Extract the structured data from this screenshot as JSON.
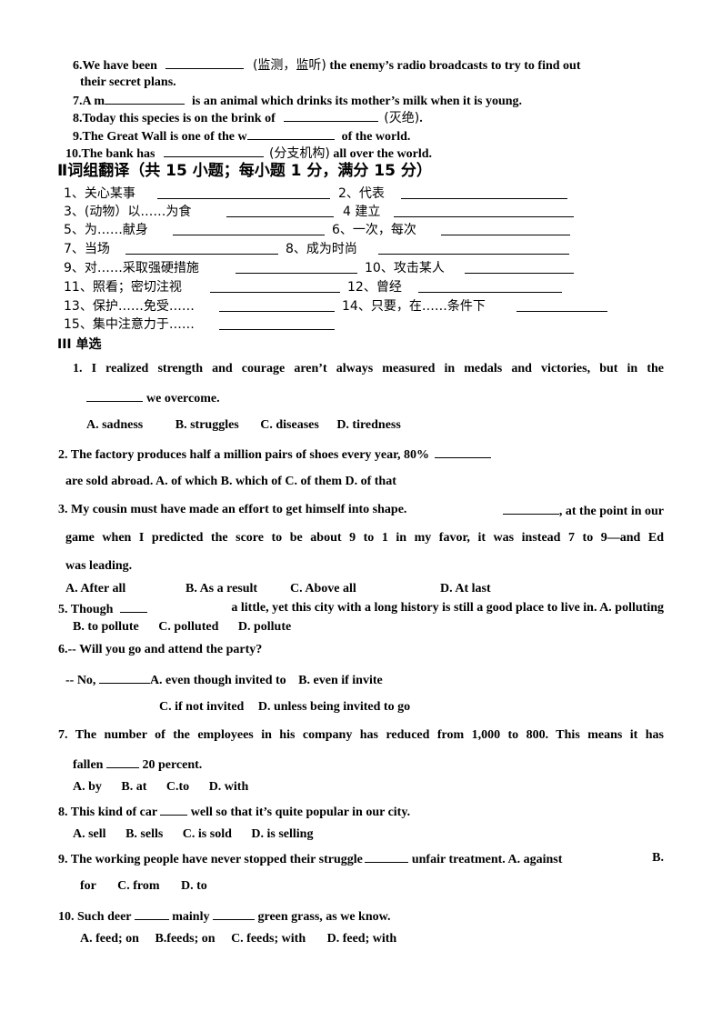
{
  "section1_tail": [
    {
      "num": "6.",
      "before": "We have been",
      "hint": "(监测，监听)",
      "after": "the enemy’s radio broadcasts to try to find out",
      "cont": "their secret plans."
    },
    {
      "num": "7.",
      "before": "A m",
      "after": "is an animal which drinks its mother’s milk when it is young."
    },
    {
      "num": "8.",
      "before": "Today this species is on the brink of",
      "hint": "(灭绝)",
      "after": "."
    },
    {
      "num": "9.",
      "before": "The Great Wall is one of the w",
      "after": "of the world."
    },
    {
      "num": "10.",
      "before": "The bank has",
      "hint": "(分支机构)",
      "after": "all over the world."
    }
  ],
  "section2": {
    "title": "Ⅱ词组翻译（共 15 小题；每小题 1 分，满分 15 分）",
    "items": [
      "1、关心某事",
      "2、代表",
      "3、(动物）以……为食",
      "4 建立",
      "5、为……献身",
      "6、一次，每次",
      "7、当场",
      "8、成为时尚",
      "9、对……采取强硬措施",
      "10、攻击某人",
      "11、照看；密切注视",
      "12、曾经",
      "13、保护……免受……",
      "14、只要，在……条件下",
      "15、集中注意力于……"
    ]
  },
  "section3": {
    "title": "III 单选",
    "q1": {
      "l1": "1. I realized strength and courage aren’t always measured in medals and victories, but in the",
      "l2": "we overcome.",
      "opts": [
        "A. sadness",
        "B. struggles",
        "C. diseases",
        "D. tiredness"
      ]
    },
    "q2": {
      "l1": "2. The factory produces half a million pairs of shoes every year, 80%",
      "l2": "are sold abroad. A. of which B. which of C. of them D. of that"
    },
    "q3": {
      "l1a": "3. My cousin must have made an effort to get himself into shape.",
      "l1b": ", at the point in our",
      "l2": "game when I predicted the score to be about 9 to 1 in my favor, it was instead 7 to 9—and Ed",
      "l3": "was leading.",
      "opts": [
        "A. After all",
        "B. As a result",
        "C. Above all",
        "D. At last"
      ]
    },
    "q5": {
      "l1a": "5. Though",
      "l1b": "a little, yet this city with a long history is still a good place to live in. A. polluting",
      "opts": [
        "B. to pollute",
        "C. polluted",
        "D. pollute"
      ]
    },
    "q6": {
      "l1": "6.-- Will you go and attend the party?",
      "l2a": "-- No,",
      "l2b": "A. even though invited to",
      "l2c": "B. even if invite",
      "opts": [
        "C. if not invited",
        "D. unless being invited to go"
      ]
    },
    "q7": {
      "l1": "7. The number of the employees in his company has reduced from 1,000 to 800. This means it has",
      "l2a": "fallen",
      "l2b": "20 percent.",
      "opts": [
        "A. by",
        "B. at",
        "C.to",
        "D. with"
      ]
    },
    "q8": {
      "l1a": "8. This kind of car",
      "l1b": "well so that it’s quite popular in our city.",
      "opts": [
        "A. sell",
        "B. sells",
        "C. is sold",
        "D. is selling"
      ]
    },
    "q9": {
      "l1a": "9. The working people have never stopped their struggle",
      "l1b": "unfair treatment. A. against",
      "l1c": "B.",
      "opts": [
        "for",
        "C. from",
        "D. to"
      ]
    },
    "q10": {
      "l1a": "10. Such deer",
      "l1b": "mainly",
      "l1c": "green grass, as we know.",
      "opts": [
        "A. feed; on",
        "B.feeds; on",
        "C. feeds; with",
        "D. feed; with"
      ]
    }
  }
}
